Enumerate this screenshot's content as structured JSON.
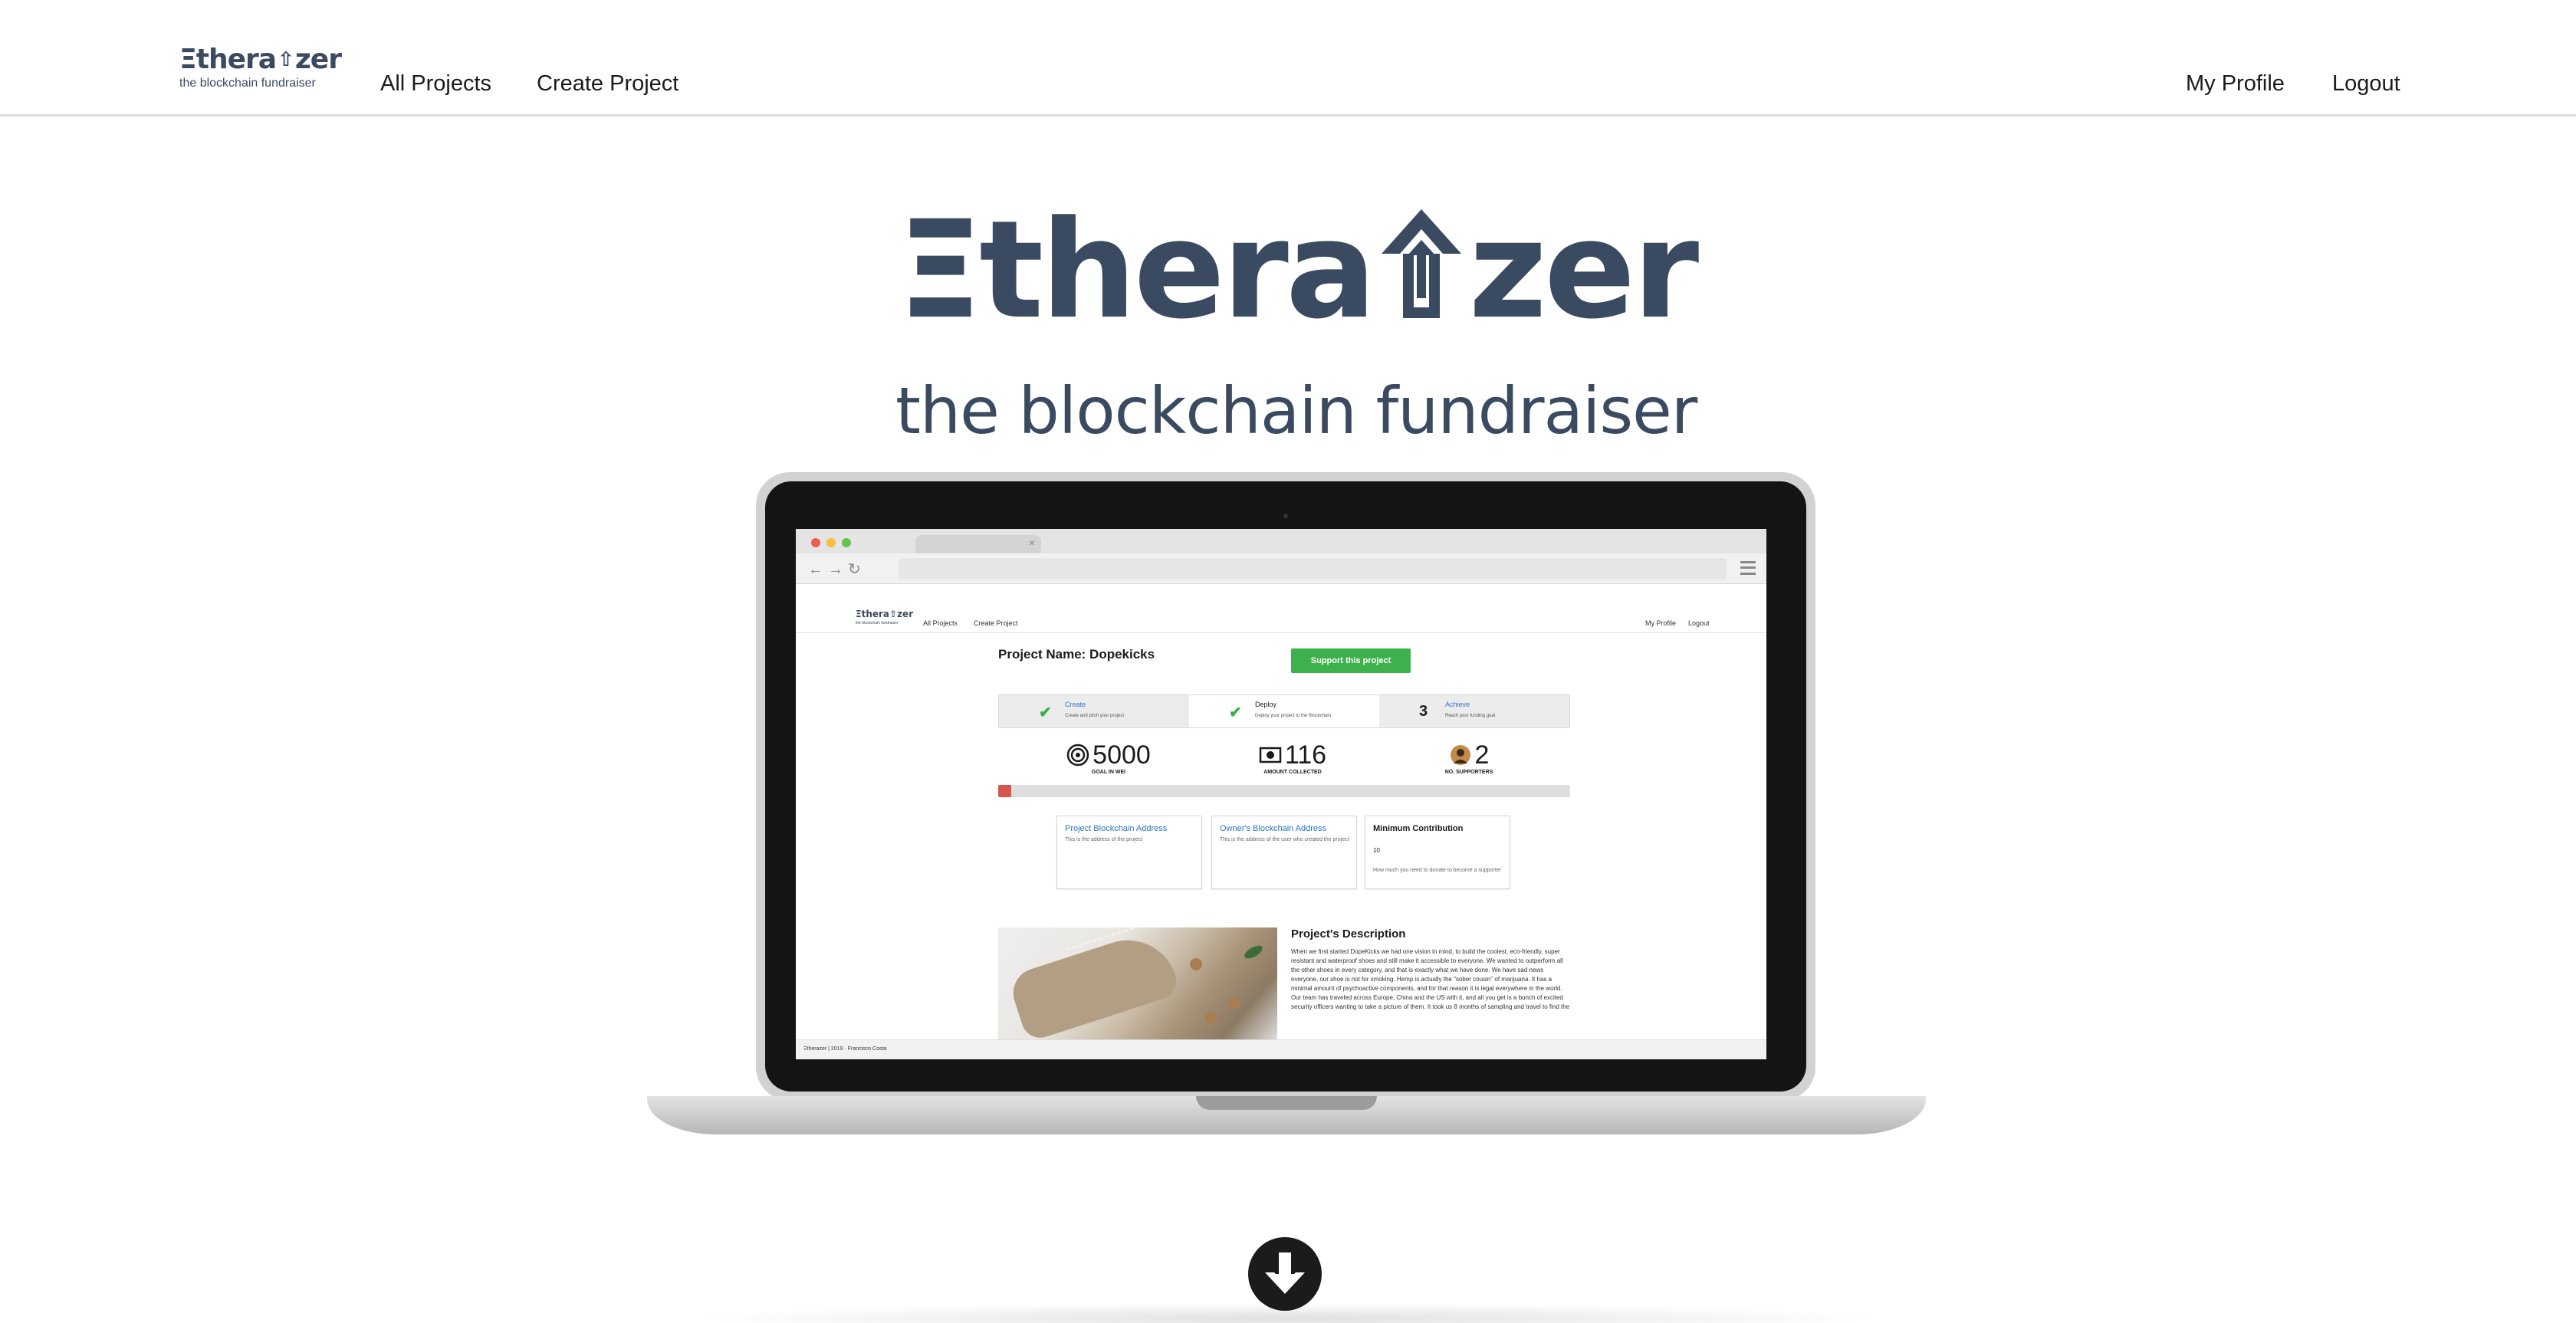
{
  "navbar": {
    "brand": {
      "word_left": "Ξthera",
      "arrow": "⇧",
      "word_right": "zer",
      "tagline": "the blockchain fundraiser"
    },
    "links": {
      "all_projects": "All Projects",
      "create_project": "Create Project",
      "my_profile": "My Profile",
      "logout": "Logout"
    }
  },
  "hero": {
    "word_left": "Ξthera",
    "word_right": "zer",
    "subtitle": "the blockchain fundraiser",
    "color": "#3a4a60"
  },
  "screenshot_preview": {
    "nav": {
      "brand": "Ξthera⇧zer",
      "brand_sub": "the blockchain fundraiser",
      "all_projects": "All Projects",
      "create_project": "Create Project",
      "my_profile": "My Profile",
      "logout": "Logout"
    },
    "project_title": "Project Name: Dopekicks",
    "support_button": "Support this project",
    "steps": [
      {
        "mark": "✔",
        "title": "Create",
        "desc": "Create and pitch your project"
      },
      {
        "mark": "✔",
        "title": "Deploy",
        "desc": "Deploy your project to the Blockchain"
      },
      {
        "mark": "3",
        "title": "Achieve",
        "desc": "Reach your funding goal"
      }
    ],
    "stats": [
      {
        "icon": "target-icon",
        "value": "5000",
        "label": "GOAL IN WEI"
      },
      {
        "icon": "money-icon",
        "value": "116",
        "label": "AMOUNT COLLECTED"
      },
      {
        "icon": "supporters-icon",
        "value": "2",
        "label": "NO. SUPPORTERS"
      }
    ],
    "progress_fraction": 0.023,
    "cards": [
      {
        "title": "Project Blockchain Address",
        "desc": "This is the address of the project"
      },
      {
        "title": "Owner's Blockchain Address",
        "desc": "This is the address of the user who created the project"
      },
      {
        "title": "Minimum Contribution",
        "value": "10",
        "help": "How much you need to donate to become a supporter"
      }
    ],
    "description_title": "Project's Description",
    "description_text": "When we first started DopeKicks we had one vision in mind, to build the coolest, eco-friendly, super resistant and waterproof shoes and still make it accessible to everyone. We wanted to outperform all the other shoes in every category, and that is exactly what we have done. We have sad news everyone, our shoe is not for smoking. Hemp is actually the \"sober cousin\" of marijuana. It has a minimal amount of psychoactive components, and for that reason it is legal everywhere in the world. Our team has traveled across Europe, China and the US with it, and all you get is a bunch of excited security officers wanting to take a picture of them. It took us 8 months of sampling and travel to find the",
    "footer": "Ξtherazer | 2019 · Francisco Costa"
  },
  "scroll_button": {
    "icon": "arrow-down-icon"
  }
}
